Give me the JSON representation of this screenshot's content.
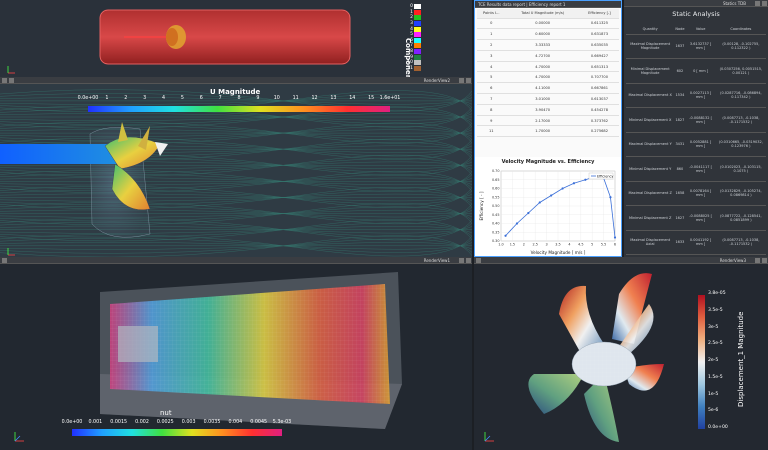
{
  "viewport_top": {
    "toolbar_title": "RenderView4",
    "legend_title": "ComponentColors",
    "legend_items": [
      {
        "label": "0",
        "color": "#ffffff"
      },
      {
        "label": "1",
        "color": "#ff2020"
      },
      {
        "label": "2",
        "color": "#20c020"
      },
      {
        "label": "3",
        "color": "#2040ff"
      },
      {
        "label": "4",
        "color": "#ffff20"
      },
      {
        "label": "5",
        "color": "#ff20ff"
      },
      {
        "label": "6",
        "color": "#20ffff"
      },
      {
        "label": "7",
        "color": "#ff8000"
      },
      {
        "label": "8",
        "color": "#8020ff"
      },
      {
        "label": "9",
        "color": "#208040"
      },
      {
        "label": "10",
        "color": "#c0c0c0"
      },
      {
        "label": "11",
        "color": "#a06030"
      }
    ]
  },
  "viewport_u": {
    "toolbar_title": "RenderView2",
    "colorbar_title": "U Magnitude",
    "ticks": [
      "0.0e+00",
      "1",
      "2",
      "3",
      "4",
      "5",
      "6",
      "7",
      "8",
      "9",
      "10",
      "11",
      "12",
      "13",
      "14",
      "15",
      "1.6e+01"
    ]
  },
  "viewport_nut": {
    "toolbar_title": "RenderView1",
    "colorbar_title": "nut",
    "ticks": [
      "0.0e+00",
      "0.001",
      "0.0015",
      "0.002",
      "0.0025",
      "0.003",
      "0.0035",
      "0.004",
      "0.0045",
      "5.3e-03"
    ]
  },
  "viewport_disp": {
    "toolbar_title": "RenderView3",
    "colorbar_title": "Displacement_1 Magnitude",
    "ticks": [
      "3.8e-05",
      "3.5e-5",
      "3e-5",
      "2.5e-5",
      "2e-5",
      "1.5e-5",
      "1e-5",
      "5e-6",
      "0.0e+00"
    ]
  },
  "spreadsheet": {
    "toolbar_title": "TCE Results data report | Efficiency report 1",
    "columns": [
      "Points I...",
      "Total U Magnitude (m/s)",
      "Efficiency [-]"
    ],
    "rows": [
      [
        "0",
        "0.00000",
        "0.611325"
      ],
      [
        "1",
        "0.60000",
        "0.631873"
      ],
      [
        "2",
        "3.33333",
        "0.635035"
      ],
      [
        "3",
        "4.72700",
        "0.669427"
      ],
      [
        "4",
        "4.70000",
        "0.651313"
      ],
      [
        "5",
        "4.70000",
        "0.707700"
      ],
      [
        "6",
        "4.11000",
        "0.667861"
      ],
      [
        "7",
        "3.01000",
        "0.613037"
      ],
      [
        "8",
        "3.90470",
        "0.454278"
      ],
      [
        "9",
        "2.17000",
        "0.373762"
      ],
      [
        "11",
        "1.70000",
        "0.275682"
      ]
    ]
  },
  "chart_data": {
    "type": "line",
    "title": "Velocity Magnitude vs. Efficiency",
    "xlabel": "Velocity Magnitude [ m/s ]",
    "ylabel": "Efficiency [ - ]",
    "xlim": [
      1,
      6
    ],
    "ylim": [
      0.3,
      0.7
    ],
    "xticks": [
      "1.0",
      "1.5",
      "2",
      "2.5",
      "3",
      "3.5",
      "4",
      "4.5",
      "5",
      "5.5",
      "6"
    ],
    "yticks": [
      "0.30",
      "0.35",
      "0.40",
      "0.45",
      "0.50",
      "0.55",
      "0.60",
      "0.65",
      "0.70"
    ],
    "legend": "Efficiency",
    "series": [
      {
        "name": "Efficiency",
        "color": "#3a6fd8",
        "x": [
          1.2,
          1.7,
          2.2,
          2.7,
          3.2,
          3.7,
          4.2,
          4.7,
          5.2,
          5.5,
          5.8,
          6.0
        ],
        "y": [
          0.33,
          0.4,
          0.46,
          0.52,
          0.56,
          0.6,
          0.63,
          0.65,
          0.67,
          0.66,
          0.55,
          0.32
        ]
      }
    ]
  },
  "static_analysis": {
    "toolbar_title": "Statics TDB",
    "title": "Static Analysis",
    "columns": [
      "Quantity",
      "Node",
      "Value",
      "Coordinates"
    ],
    "rows": [
      [
        "Maximal Displacement Magnitude",
        "1637",
        "3.6132737 [ mm ]",
        "(0.00128, -0.102755, 0.112322 )"
      ],
      [
        "Minimal Displacement Magnitude",
        "602",
        "0 [ mm ]",
        "(0.0307256, 0.0051515, 0.00121 )"
      ],
      [
        "Maximal Displacement X",
        "1534",
        "0.0027113 [ mm ]",
        "(0.0287716, -0.086894, 0.117342 )"
      ],
      [
        "Minimal Displacement X",
        "1827",
        "-0.0088132 [ mm ]",
        "(0.0087713, -0.1038, -0.1171532 )"
      ],
      [
        "Maximal Displacement Y",
        "3431",
        "0.0052881 [ mm ]",
        "(0.0310665, -0.0319032, 0.123976 )"
      ],
      [
        "Minimal Displacement Y",
        "860",
        "-0.0041117 [ mm ]",
        "(0.0102023, -0.103115, 0.1075 )"
      ],
      [
        "Maximal Displacement Z",
        "1658",
        "0.0078164 [ mm ]",
        "(0.0132829, -0.105274, 0.0869814 )"
      ],
      [
        "Minimal Displacement Z",
        "1627",
        "-0.0088025 [ mm ]",
        "(0.0877722, -0.128541, 0.0851899 )"
      ],
      [
        "Maximal Displacement Axial",
        "1633",
        "0.0041192 [ mm ]",
        "(0.0087713, -0.1038, -0.1171532 )"
      ]
    ]
  },
  "colors": {
    "background": "#1c1f24",
    "render_bg": "#33404a",
    "toolbar": "#3a3d42",
    "active_border": "#4aa0ff"
  }
}
